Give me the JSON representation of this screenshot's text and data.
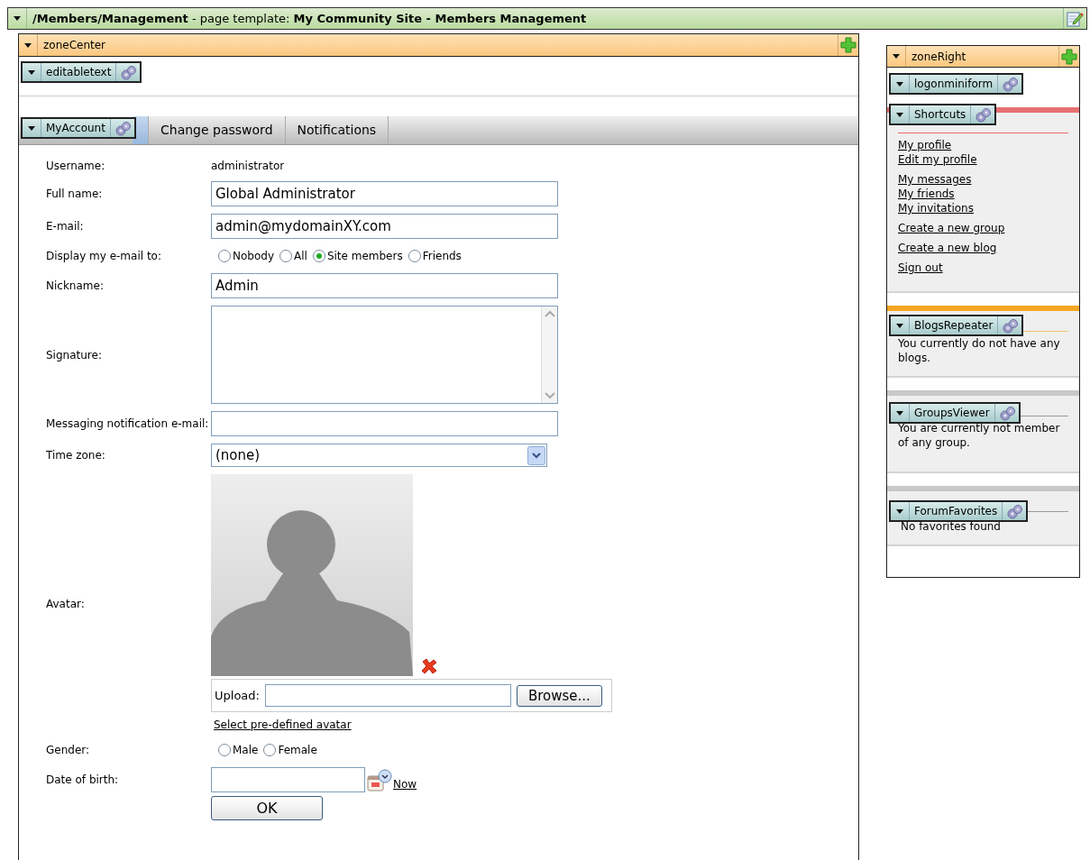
{
  "page_bar": {
    "path": "/Members/Management",
    "template_label": "- page template:",
    "template": "My Community Site - Members Management"
  },
  "zone_center": {
    "title": "zoneCenter",
    "heading_webpart": "editabletext",
    "tabs_webpart": "MyAccount",
    "tabs": [
      {
        "selected": true
      },
      {
        "label": "Change password",
        "selected": false
      },
      {
        "label": "Notifications",
        "selected": false
      }
    ],
    "form": [
      {
        "kind": "text",
        "label": "Username:",
        "value": "administrator"
      },
      {
        "kind": "input",
        "label": "Full name:",
        "value": "Global Administrator"
      },
      {
        "kind": "input",
        "label": "E-mail:",
        "value": "admin@mydomainXY.com"
      },
      {
        "kind": "radios",
        "label": "Display my e-mail to:",
        "options": [
          {
            "label": "Nobody",
            "selected": false
          },
          {
            "label": "All",
            "selected": false
          },
          {
            "label": "Site members",
            "selected": true
          },
          {
            "label": "Friends",
            "selected": false
          }
        ]
      },
      {
        "kind": "input",
        "label": "Nickname:",
        "value": "Admin"
      },
      {
        "kind": "textarea",
        "label": "Signature:"
      },
      {
        "kind": "input",
        "label": "Messaging notification e-mail:"
      },
      {
        "kind": "select",
        "label": "Time zone:",
        "value": "(none)"
      },
      {
        "kind": "avatar",
        "label": "Avatar:",
        "upload_label": "Upload:",
        "browse": "Browse...",
        "link": "Select pre-defined avatar"
      },
      {
        "kind": "radios",
        "label": "Gender:",
        "options": [
          {
            "label": "Male",
            "selected": false
          },
          {
            "label": "Female",
            "selected": false
          }
        ]
      },
      {
        "kind": "date",
        "label": "Date of birth:",
        "link": "Now"
      }
    ],
    "submit": "OK"
  },
  "zone_right": {
    "title": "zoneRight",
    "webparts": [
      {
        "name": "logonminiform"
      },
      {
        "name": "Shortcuts",
        "color": "#e87070",
        "link_groups": [
          [
            "My profile",
            "Edit my profile"
          ],
          [
            "My messages",
            "My friends",
            "My invitations"
          ],
          [
            "Create a new group"
          ],
          [
            "Create a new blog"
          ],
          [
            "Sign out"
          ]
        ]
      },
      {
        "name": "BlogsRepeater",
        "color": "#f5a623",
        "text": "You currently do not have any blogs."
      },
      {
        "name": "GroupsViewer",
        "color": "#c8c8c8",
        "text": "You are currently not member of any group."
      },
      {
        "name": "ForumFavorites",
        "color": "#c8c8c8",
        "text": "No favorites found"
      }
    ]
  }
}
